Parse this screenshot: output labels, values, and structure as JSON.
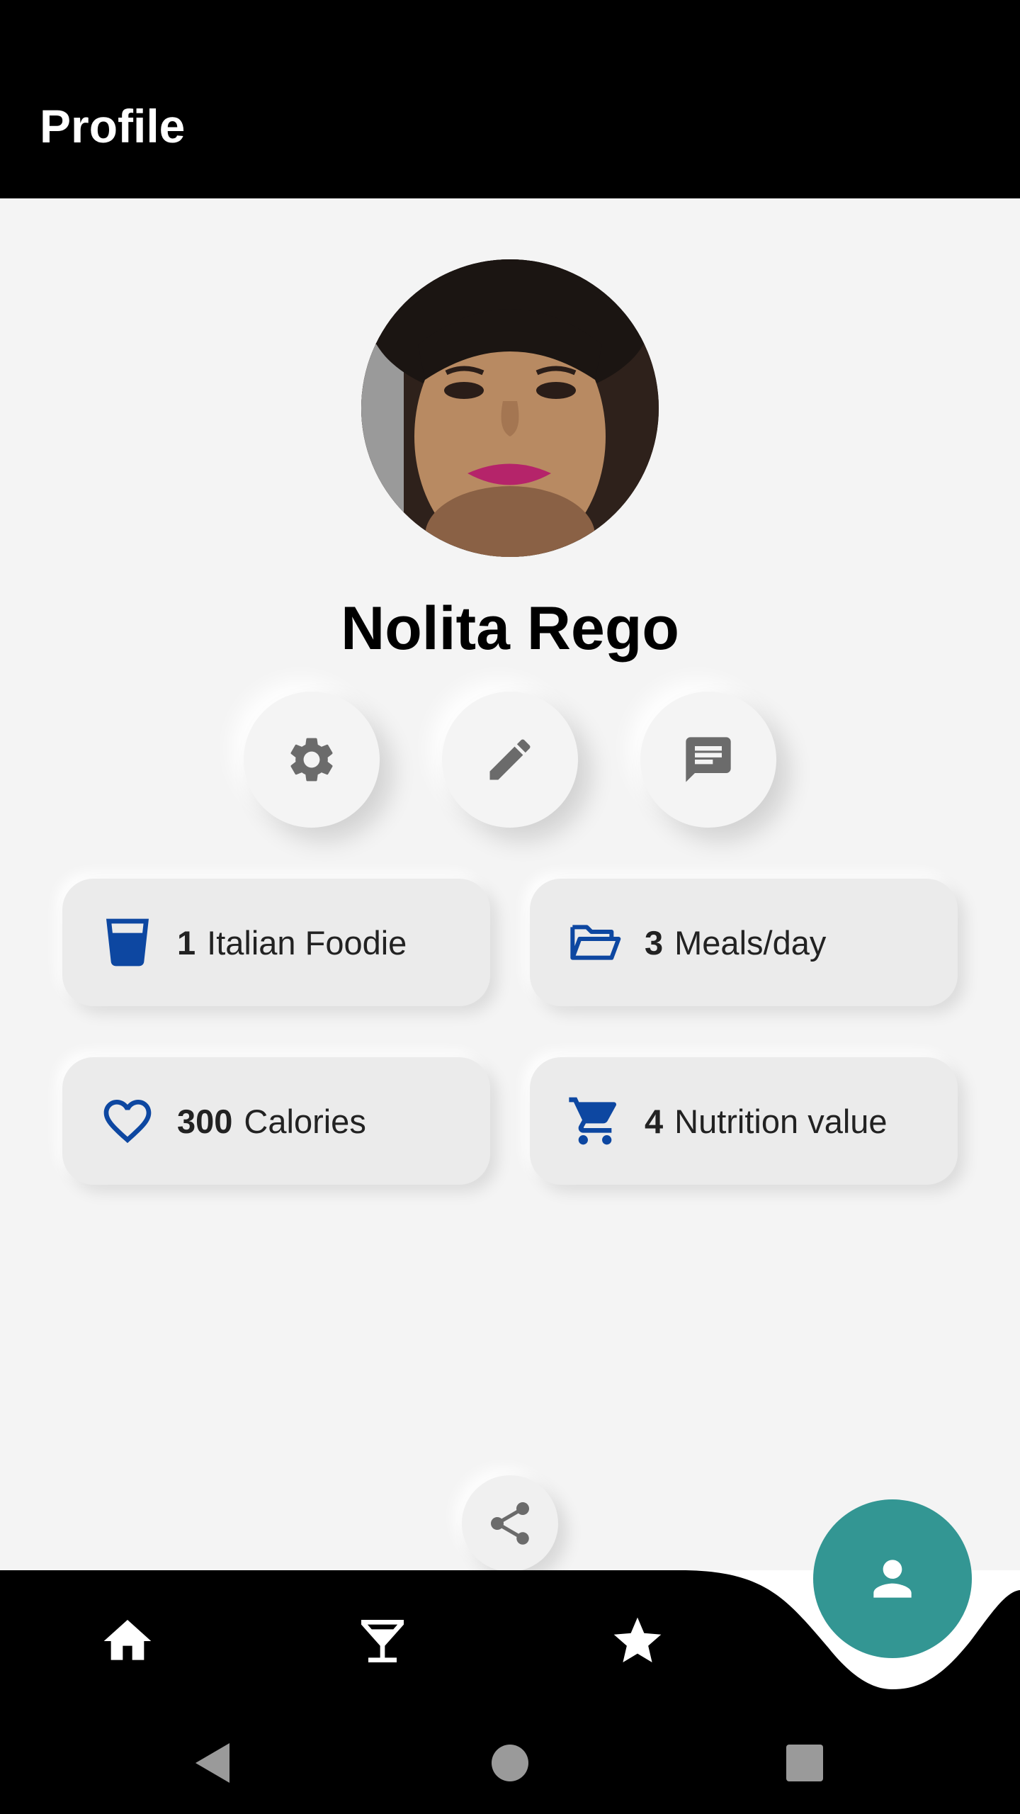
{
  "app_bar": {
    "title": "Profile"
  },
  "profile": {
    "name": "Nolita Rego"
  },
  "actions": [
    {
      "icon": "gear-icon"
    },
    {
      "icon": "pencil-icon"
    },
    {
      "icon": "chat-icon"
    }
  ],
  "stats": [
    {
      "value": "1",
      "label": "Italian Foodie",
      "icon": "cup-icon"
    },
    {
      "value": "3",
      "label": "Meals/day",
      "icon": "folder-icon"
    },
    {
      "value": "300",
      "label": "Calories",
      "icon": "heart-icon"
    },
    {
      "value": "4",
      "label": "Nutrition value",
      "icon": "cart-icon"
    }
  ],
  "share": {
    "icon": "share-icon"
  },
  "bottom_nav": {
    "items": [
      {
        "icon": "home-icon"
      },
      {
        "icon": "cocktail-icon"
      },
      {
        "icon": "star-icon"
      }
    ],
    "active": {
      "icon": "person-icon"
    }
  },
  "system_nav": [
    "back-icon",
    "home-circle-icon",
    "recents-icon"
  ],
  "colors": {
    "accent_blue": "#0d47a1",
    "fab_teal": "#339693",
    "icon_gray": "#6b6b6b",
    "background": "#f4f4f4"
  }
}
